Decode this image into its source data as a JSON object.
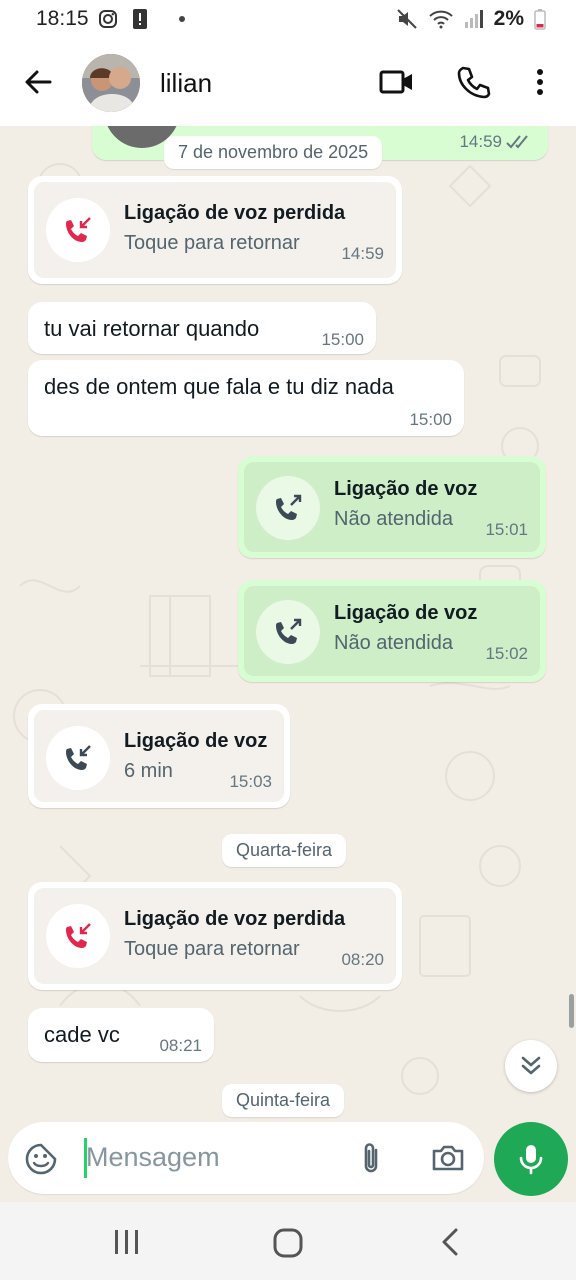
{
  "status_bar": {
    "time": "18:15",
    "battery_percent": "2%",
    "icons": [
      "instagram-icon",
      "alert-icon",
      "dot-icon",
      "mute-icon",
      "wifi-icon",
      "signal-icon",
      "battery-low-icon"
    ]
  },
  "header": {
    "contact_name": "lilian",
    "icons": [
      "back-arrow-icon",
      "video-call-icon",
      "voice-call-icon",
      "more-options-icon"
    ]
  },
  "chat": {
    "top_partial_message": {
      "time": "14:59",
      "status": "read"
    },
    "date_separators": [
      "7 de novembro de 2025",
      "Quarta-feira",
      "Quinta-feira"
    ],
    "messages": [
      {
        "type": "call",
        "direction": "in",
        "title": "Ligação de voz perdida",
        "subtitle": "Toque para retornar",
        "time": "14:59"
      },
      {
        "type": "text",
        "direction": "in",
        "text": "tu vai retornar quando",
        "time": "15:00"
      },
      {
        "type": "text",
        "direction": "in",
        "text": "des de ontem que fala e tu diz nada",
        "time": "15:00"
      },
      {
        "type": "call",
        "direction": "out",
        "title": "Ligação de voz",
        "subtitle": "Não atendida",
        "time": "15:01"
      },
      {
        "type": "call",
        "direction": "out",
        "title": "Ligação de voz",
        "subtitle": "Não atendida",
        "time": "15:02"
      },
      {
        "type": "call",
        "direction": "in",
        "title": "Ligação de voz",
        "subtitle": "6 min",
        "time": "15:03"
      },
      {
        "type": "call",
        "direction": "in",
        "title": "Ligação de voz perdida",
        "subtitle": "Toque para retornar",
        "time": "08:20"
      },
      {
        "type": "text",
        "direction": "in",
        "text": "cade vc",
        "time": "08:21"
      }
    ]
  },
  "composer": {
    "placeholder": "Mensagem",
    "icons": [
      "sticker-icon",
      "attach-icon",
      "camera-icon",
      "mic-icon"
    ]
  },
  "colors": {
    "outgoing_bubble": "#d9fdd3",
    "incoming_bubble": "#ffffff",
    "chat_background": "#f2ede5",
    "accent_green": "#1fa855",
    "missed_call_red": "#e0284f"
  }
}
